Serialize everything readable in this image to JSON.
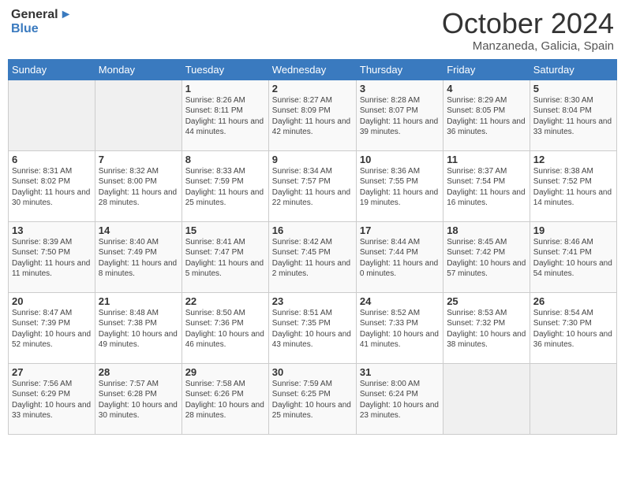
{
  "header": {
    "logo_general": "General",
    "logo_blue": "Blue",
    "month_title": "October 2024",
    "subtitle": "Manzaneda, Galicia, Spain"
  },
  "days_of_week": [
    "Sunday",
    "Monday",
    "Tuesday",
    "Wednesday",
    "Thursday",
    "Friday",
    "Saturday"
  ],
  "weeks": [
    [
      {
        "day": "",
        "sunrise": "",
        "sunset": "",
        "daylight": ""
      },
      {
        "day": "",
        "sunrise": "",
        "sunset": "",
        "daylight": ""
      },
      {
        "day": "1",
        "sunrise": "Sunrise: 8:26 AM",
        "sunset": "Sunset: 8:11 PM",
        "daylight": "Daylight: 11 hours and 44 minutes."
      },
      {
        "day": "2",
        "sunrise": "Sunrise: 8:27 AM",
        "sunset": "Sunset: 8:09 PM",
        "daylight": "Daylight: 11 hours and 42 minutes."
      },
      {
        "day": "3",
        "sunrise": "Sunrise: 8:28 AM",
        "sunset": "Sunset: 8:07 PM",
        "daylight": "Daylight: 11 hours and 39 minutes."
      },
      {
        "day": "4",
        "sunrise": "Sunrise: 8:29 AM",
        "sunset": "Sunset: 8:05 PM",
        "daylight": "Daylight: 11 hours and 36 minutes."
      },
      {
        "day": "5",
        "sunrise": "Sunrise: 8:30 AM",
        "sunset": "Sunset: 8:04 PM",
        "daylight": "Daylight: 11 hours and 33 minutes."
      }
    ],
    [
      {
        "day": "6",
        "sunrise": "Sunrise: 8:31 AM",
        "sunset": "Sunset: 8:02 PM",
        "daylight": "Daylight: 11 hours and 30 minutes."
      },
      {
        "day": "7",
        "sunrise": "Sunrise: 8:32 AM",
        "sunset": "Sunset: 8:00 PM",
        "daylight": "Daylight: 11 hours and 28 minutes."
      },
      {
        "day": "8",
        "sunrise": "Sunrise: 8:33 AM",
        "sunset": "Sunset: 7:59 PM",
        "daylight": "Daylight: 11 hours and 25 minutes."
      },
      {
        "day": "9",
        "sunrise": "Sunrise: 8:34 AM",
        "sunset": "Sunset: 7:57 PM",
        "daylight": "Daylight: 11 hours and 22 minutes."
      },
      {
        "day": "10",
        "sunrise": "Sunrise: 8:36 AM",
        "sunset": "Sunset: 7:55 PM",
        "daylight": "Daylight: 11 hours and 19 minutes."
      },
      {
        "day": "11",
        "sunrise": "Sunrise: 8:37 AM",
        "sunset": "Sunset: 7:54 PM",
        "daylight": "Daylight: 11 hours and 16 minutes."
      },
      {
        "day": "12",
        "sunrise": "Sunrise: 8:38 AM",
        "sunset": "Sunset: 7:52 PM",
        "daylight": "Daylight: 11 hours and 14 minutes."
      }
    ],
    [
      {
        "day": "13",
        "sunrise": "Sunrise: 8:39 AM",
        "sunset": "Sunset: 7:50 PM",
        "daylight": "Daylight: 11 hours and 11 minutes."
      },
      {
        "day": "14",
        "sunrise": "Sunrise: 8:40 AM",
        "sunset": "Sunset: 7:49 PM",
        "daylight": "Daylight: 11 hours and 8 minutes."
      },
      {
        "day": "15",
        "sunrise": "Sunrise: 8:41 AM",
        "sunset": "Sunset: 7:47 PM",
        "daylight": "Daylight: 11 hours and 5 minutes."
      },
      {
        "day": "16",
        "sunrise": "Sunrise: 8:42 AM",
        "sunset": "Sunset: 7:45 PM",
        "daylight": "Daylight: 11 hours and 2 minutes."
      },
      {
        "day": "17",
        "sunrise": "Sunrise: 8:44 AM",
        "sunset": "Sunset: 7:44 PM",
        "daylight": "Daylight: 11 hours and 0 minutes."
      },
      {
        "day": "18",
        "sunrise": "Sunrise: 8:45 AM",
        "sunset": "Sunset: 7:42 PM",
        "daylight": "Daylight: 10 hours and 57 minutes."
      },
      {
        "day": "19",
        "sunrise": "Sunrise: 8:46 AM",
        "sunset": "Sunset: 7:41 PM",
        "daylight": "Daylight: 10 hours and 54 minutes."
      }
    ],
    [
      {
        "day": "20",
        "sunrise": "Sunrise: 8:47 AM",
        "sunset": "Sunset: 7:39 PM",
        "daylight": "Daylight: 10 hours and 52 minutes."
      },
      {
        "day": "21",
        "sunrise": "Sunrise: 8:48 AM",
        "sunset": "Sunset: 7:38 PM",
        "daylight": "Daylight: 10 hours and 49 minutes."
      },
      {
        "day": "22",
        "sunrise": "Sunrise: 8:50 AM",
        "sunset": "Sunset: 7:36 PM",
        "daylight": "Daylight: 10 hours and 46 minutes."
      },
      {
        "day": "23",
        "sunrise": "Sunrise: 8:51 AM",
        "sunset": "Sunset: 7:35 PM",
        "daylight": "Daylight: 10 hours and 43 minutes."
      },
      {
        "day": "24",
        "sunrise": "Sunrise: 8:52 AM",
        "sunset": "Sunset: 7:33 PM",
        "daylight": "Daylight: 10 hours and 41 minutes."
      },
      {
        "day": "25",
        "sunrise": "Sunrise: 8:53 AM",
        "sunset": "Sunset: 7:32 PM",
        "daylight": "Daylight: 10 hours and 38 minutes."
      },
      {
        "day": "26",
        "sunrise": "Sunrise: 8:54 AM",
        "sunset": "Sunset: 7:30 PM",
        "daylight": "Daylight: 10 hours and 36 minutes."
      }
    ],
    [
      {
        "day": "27",
        "sunrise": "Sunrise: 7:56 AM",
        "sunset": "Sunset: 6:29 PM",
        "daylight": "Daylight: 10 hours and 33 minutes."
      },
      {
        "day": "28",
        "sunrise": "Sunrise: 7:57 AM",
        "sunset": "Sunset: 6:28 PM",
        "daylight": "Daylight: 10 hours and 30 minutes."
      },
      {
        "day": "29",
        "sunrise": "Sunrise: 7:58 AM",
        "sunset": "Sunset: 6:26 PM",
        "daylight": "Daylight: 10 hours and 28 minutes."
      },
      {
        "day": "30",
        "sunrise": "Sunrise: 7:59 AM",
        "sunset": "Sunset: 6:25 PM",
        "daylight": "Daylight: 10 hours and 25 minutes."
      },
      {
        "day": "31",
        "sunrise": "Sunrise: 8:00 AM",
        "sunset": "Sunset: 6:24 PM",
        "daylight": "Daylight: 10 hours and 23 minutes."
      },
      {
        "day": "",
        "sunrise": "",
        "sunset": "",
        "daylight": ""
      },
      {
        "day": "",
        "sunrise": "",
        "sunset": "",
        "daylight": ""
      }
    ]
  ]
}
